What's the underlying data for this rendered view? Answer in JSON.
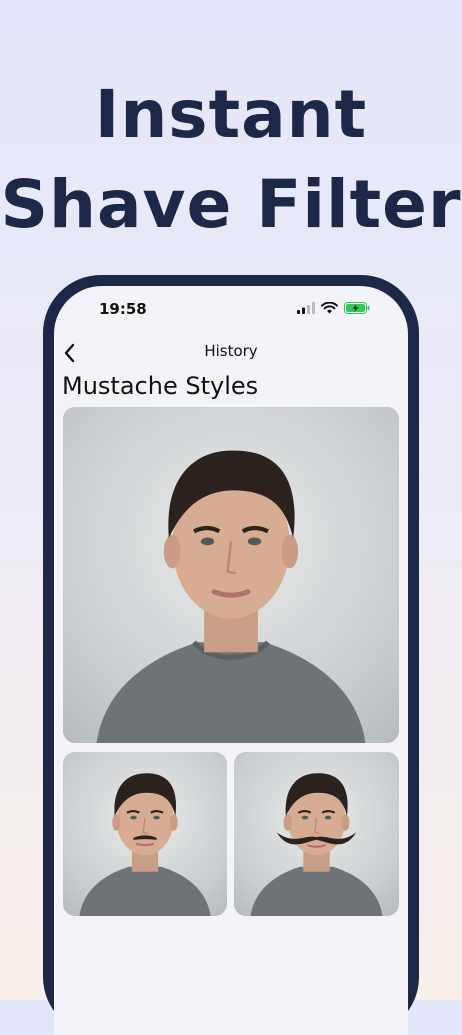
{
  "headline": {
    "line1": "Instant",
    "line2": "Shave Filter"
  },
  "status_bar": {
    "time": "19:58",
    "icons": [
      "cellular-signal-icon",
      "wifi-icon",
      "battery-charging-icon"
    ],
    "battery_color": "#34c759"
  },
  "navbar": {
    "back_icon": "chevron-left-icon",
    "title": "History"
  },
  "section": {
    "title": "Mustache Styles"
  },
  "photos": [
    {
      "name": "original-portrait",
      "mustache": "none"
    },
    {
      "name": "thin-mustache-result",
      "mustache": "thin"
    },
    {
      "name": "handlebar-mustache-result",
      "mustache": "handlebar"
    }
  ],
  "colors": {
    "headline": "#1d2747",
    "phone_frame": "#1d2747",
    "screen_bg": "#f4f3f9"
  }
}
